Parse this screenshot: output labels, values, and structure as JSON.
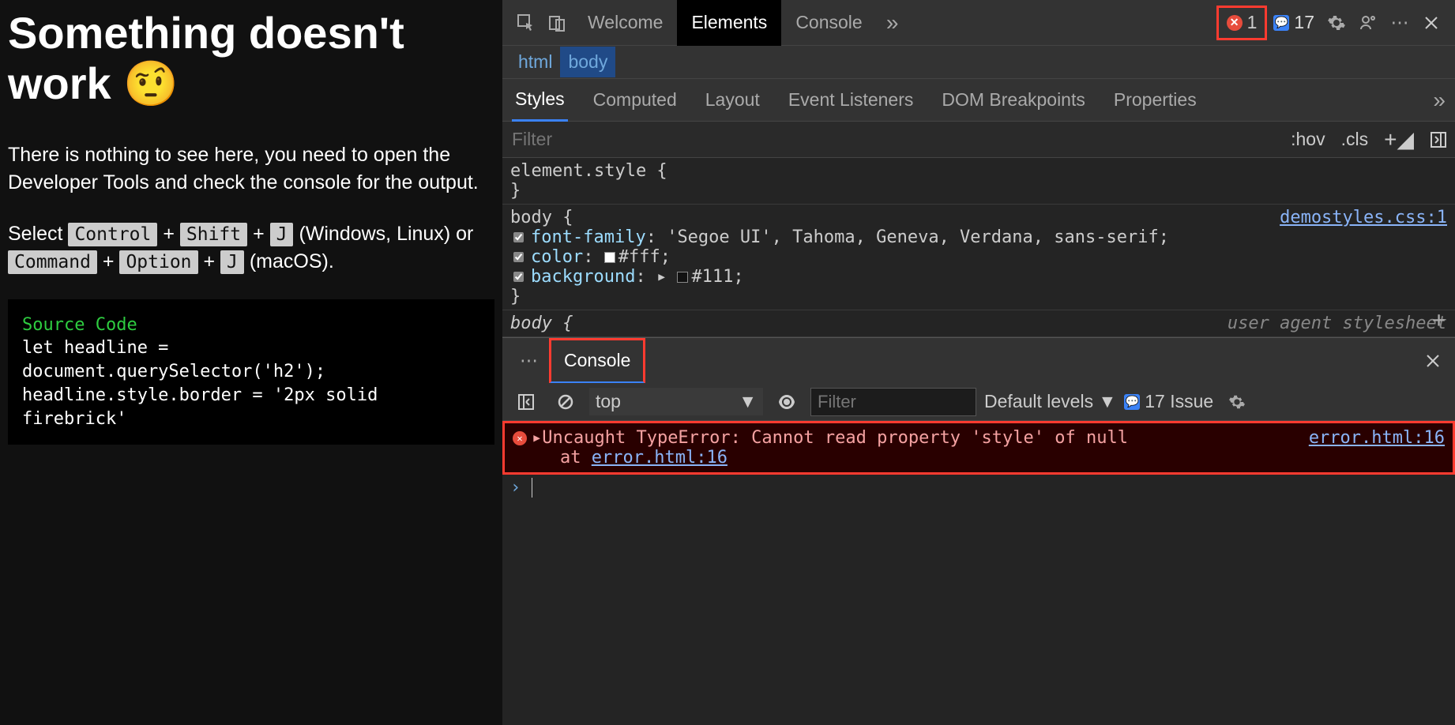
{
  "page": {
    "heading": "Something doesn't work 🤨",
    "para1": "There is nothing to see here, you need to open the Developer Tools and check the console for the output.",
    "select_prefix": "Select ",
    "kbd_ctrl": "Control",
    "kbd_shift": "Shift",
    "kbd_j": "J",
    "win_suffix": " (Windows, Linux) or ",
    "kbd_cmd": "Command",
    "kbd_opt": "Option",
    "mac_suffix": " (macOS).",
    "src_title": "Source Code",
    "src_line1": "let headline = document.querySelector('h2');",
    "src_line2": "headline.style.border = '2px solid firebrick'"
  },
  "devtools": {
    "tabs": {
      "welcome": "Welcome",
      "elements": "Elements",
      "console": "Console"
    },
    "error_count": "1",
    "issue_count": "17",
    "breadcrumb": {
      "html": "html",
      "body": "body"
    },
    "subtabs": {
      "styles": "Styles",
      "computed": "Computed",
      "layout": "Layout",
      "eventlisteners": "Event Listeners",
      "dombp": "DOM Breakpoints",
      "props": "Properties"
    },
    "filter_placeholder": "Filter",
    "hov": ":hov",
    "cls": ".cls",
    "styles": {
      "elem_style_open": "element.style {",
      "elem_style_close": "}",
      "body_sel": "body {",
      "body_link": "demostyles.css:1",
      "d1_prop": "font-family",
      "d1_val": ": 'Segoe UI', Tahoma, Geneva, Verdana, sans-serif;",
      "d2_prop": "color",
      "d2_val": "#fff;",
      "d3_prop": "background",
      "d3_val": "#111;",
      "close2": "}",
      "ua_sel": "body {",
      "ua_src": "user agent stylesheet"
    },
    "drawer_tab": "Console",
    "context": "top",
    "levels": "Default levels ▼",
    "issues_text": "17 Issue",
    "console_filter_placeholder": "Filter",
    "error_msg": "Uncaught TypeError: Cannot read property 'style' of null",
    "error_src": "error.html:16",
    "error_stack_prefix": "at ",
    "error_stack_link": "error.html:16",
    "prompt": "›"
  }
}
